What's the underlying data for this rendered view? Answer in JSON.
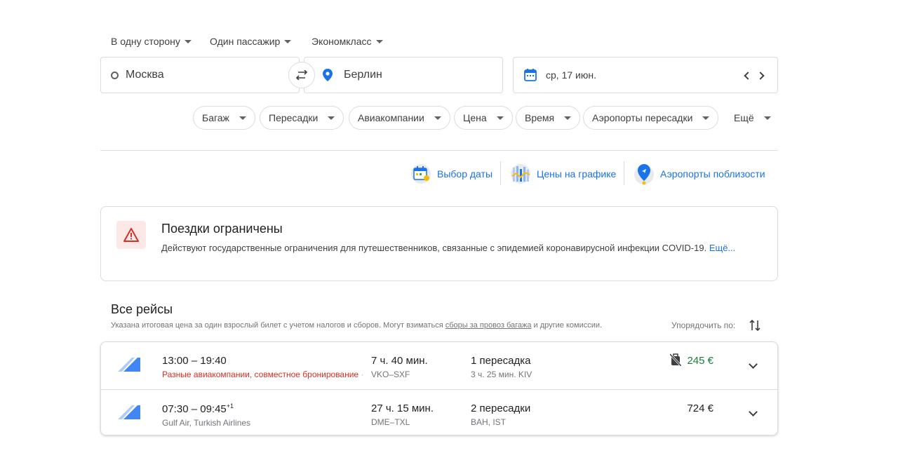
{
  "trip_options": {
    "trip_type": "В одну сторону",
    "passengers": "Один пассажир",
    "cabin": "Экономкласс"
  },
  "search": {
    "origin": "Москва",
    "destination": "Берлин",
    "date": "ср, 17 июн."
  },
  "filters": [
    "Багаж",
    "Пересадки",
    "Авиакомпании",
    "Цена",
    "Время",
    "Аэропорты пересадки",
    "Ещё"
  ],
  "tools": {
    "date_grid": "Выбор даты",
    "price_graph": "Цены на графике",
    "nearby_airports": "Аэропорты поблизости"
  },
  "alert": {
    "title": "Поездки ограничены",
    "body": "Действуют государственные ограничения для путешественников, связанные с эпидемией коронавирусной инфекции COVID-19.",
    "more": "Ещё..."
  },
  "results": {
    "title": "Все рейсы",
    "note_before": "Указана итоговая цена за один взрослый билет с учетом налогов и сборов. Могут взиматься ",
    "note_link": "сборы за провоз багажа",
    "note_after": " и другие комиссии.",
    "sort_label": "Упорядочить по:"
  },
  "flights": [
    {
      "depart": "13:00",
      "arrive": "19:40",
      "day_offset": "",
      "airline": "Разные авиакомпании, совместное бронирование",
      "duration": "7 ч. 40 мин.",
      "route": "VKO–SXF",
      "stops": "1 пересадка",
      "stop_detail": "3 ч. 25 мин. KIV",
      "price": "245 €",
      "price_color": "#188038",
      "no_bag_icon": true
    },
    {
      "depart": "07:30",
      "arrive": "09:45",
      "day_offset": "+1",
      "airline": "Gulf Air, Turkish Airlines",
      "duration": "27 ч. 15 мин.",
      "route": "DME–TXL",
      "stops": "2 пересадки",
      "stop_detail": "BAH, IST",
      "price": "724 €",
      "price_color": "#202124",
      "no_bag_icon": false
    }
  ],
  "colors": {
    "accent": "#1a73e8",
    "warning": "#d93025",
    "good_price": "#188038",
    "border": "#dadce0"
  }
}
